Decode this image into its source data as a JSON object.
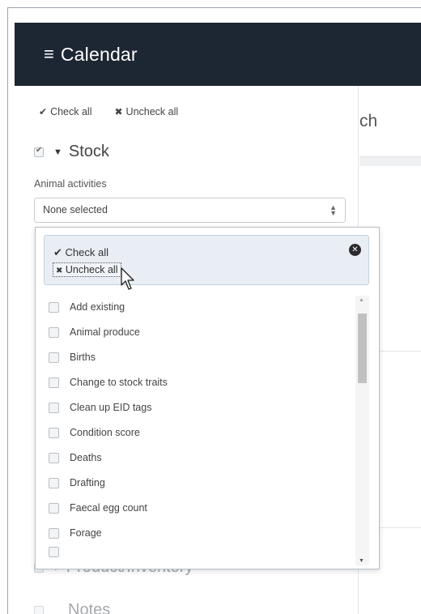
{
  "header": {
    "title": "Calendar",
    "menu_icon": "hamburger-menu-icon"
  },
  "sidebar": {
    "check_all": "Check all",
    "uncheck_all": "Uncheck all",
    "group": {
      "label": "Stock",
      "checked": true
    },
    "field_label": "Animal activities",
    "select_value": "None selected"
  },
  "dropdown": {
    "check_all": "Check all",
    "uncheck_all": "Uncheck all",
    "options": [
      "Add existing",
      "Animal produce",
      "Births",
      "Change to stock traits",
      "Clean up EID tags",
      "Condition score",
      "Deaths",
      "Drafting",
      "Faecal egg count",
      "Forage"
    ]
  },
  "behind": {
    "product_label": "Product/Inventory",
    "notes_label": "Notes"
  },
  "main": {
    "heading_fragment": "ch"
  },
  "colors": {
    "topbar": "#1d2633",
    "dropdown_actions_bg": "#e9eef5"
  }
}
